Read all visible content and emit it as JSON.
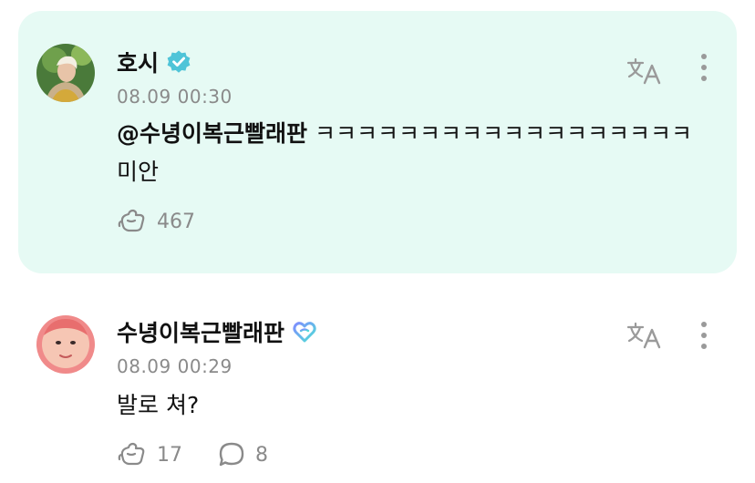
{
  "posts": [
    {
      "author": "호시",
      "badge_icon": "verified-check-icon",
      "timestamp": "08.09 00:30",
      "mention": "@수녕이복근빨래판",
      "text": " ㅋㅋㅋㅋㅋㅋㅋㅋㅋㅋㅋㅋㅋㅋㅋㅋㅋㅋ미안",
      "likes": "467",
      "highlighted": true
    },
    {
      "author": "수녕이복근빨래판",
      "badge_icon": "heart-membership-icon",
      "timestamp": "08.09 00:29",
      "text": "발로 쳐?",
      "likes": "17",
      "comments": "8",
      "highlighted": false
    }
  ],
  "icons": {
    "translate": "translate-icon",
    "more": "more-vertical-icon",
    "like": "like-hand-icon",
    "comment": "comment-bubble-icon"
  },
  "colors": {
    "highlight_bg": "#e6faf4",
    "verified": "#4fc4d8",
    "muted_text": "#8a8a8a",
    "heart_gradient_start": "#7f8cff",
    "heart_gradient_end": "#4ee0d6"
  }
}
